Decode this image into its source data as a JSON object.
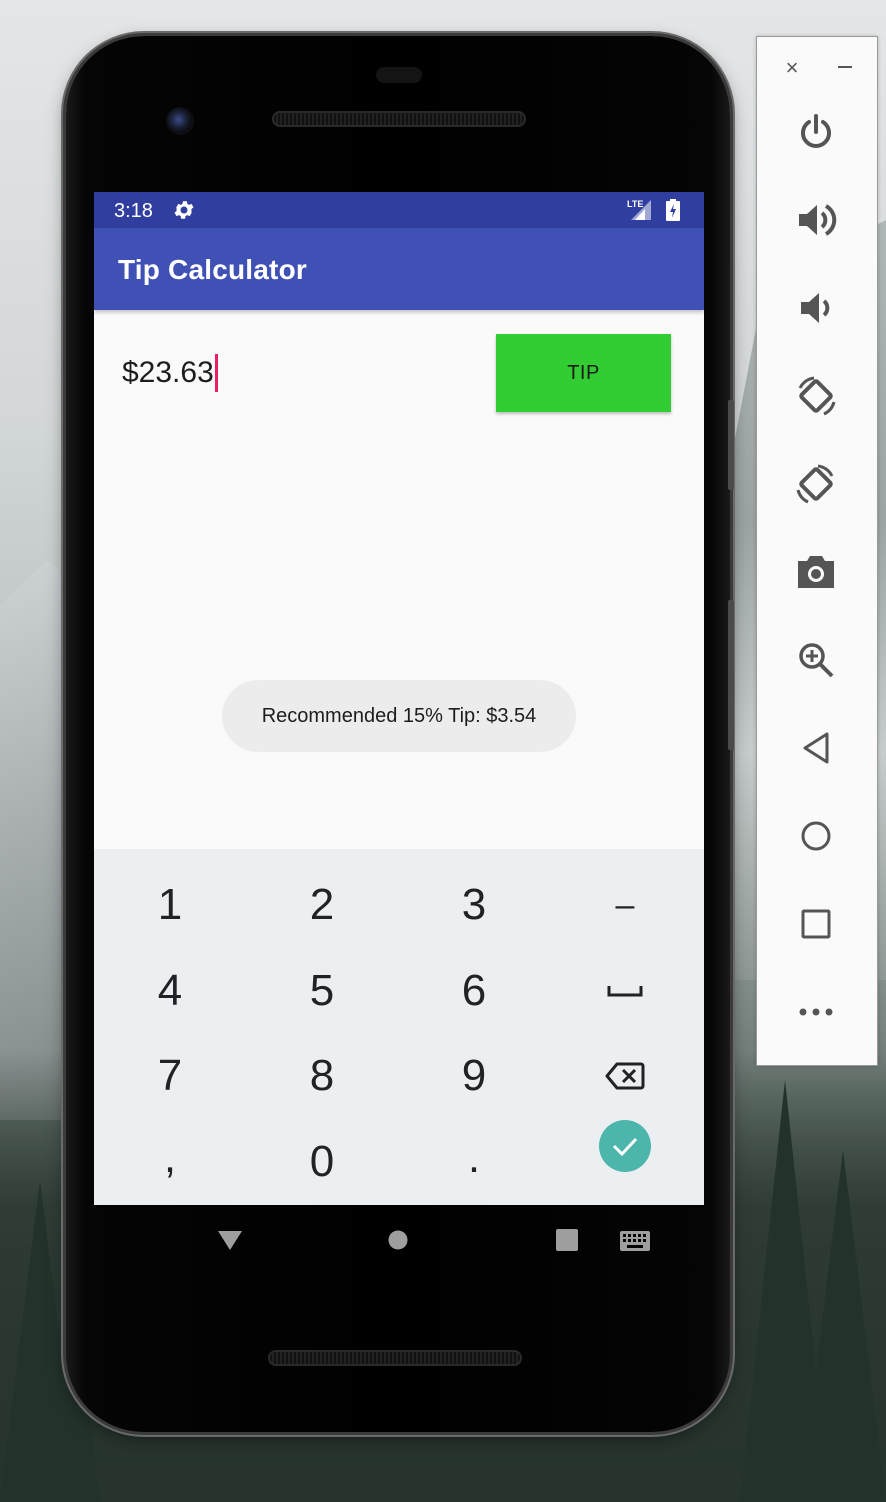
{
  "status_bar": {
    "time": "3:18",
    "icons": [
      "gear-icon",
      "lte-signal-icon",
      "battery-charging-icon"
    ],
    "network": "LTE"
  },
  "app_bar": {
    "title": "Tip Calculator",
    "color": "#3f51b5",
    "status_color": "#303f9f"
  },
  "main": {
    "amount_value": "$23.63",
    "tip_button_label": "TIP",
    "tip_button_color": "#32cd32",
    "cursor_color": "#e91e63"
  },
  "toast": {
    "message": "Recommended 15% Tip: $3.54"
  },
  "keyboard": {
    "rows": [
      [
        "1",
        "2",
        "3",
        "–"
      ],
      [
        "4",
        "5",
        "6",
        "space"
      ],
      [
        "7",
        "8",
        "9",
        "backspace"
      ],
      [
        ",",
        "0",
        ".",
        "done"
      ]
    ],
    "done_color": "#4db6ac"
  },
  "navigation": {
    "buttons": [
      "back-icon",
      "home-icon",
      "recents-icon",
      "keyboard-icon"
    ]
  },
  "emulator_panel": {
    "close_glyph": "×",
    "tools": [
      "power-icon",
      "volume-up-icon",
      "volume-down-icon",
      "rotate-left-icon",
      "rotate-right-icon",
      "camera-icon",
      "zoom-icon",
      "back-icon",
      "home-icon",
      "overview-icon",
      "more-icon"
    ]
  }
}
